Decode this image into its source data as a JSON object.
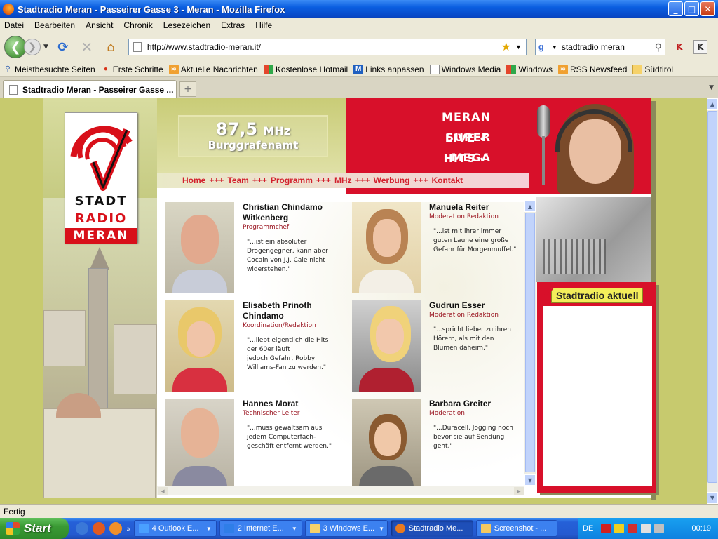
{
  "window": {
    "title": "Stadtradio Meran - Passeirer Gasse 3 - Meran - Mozilla Firefox",
    "min": "_",
    "max": "□",
    "close": "✕"
  },
  "menu": [
    "Datei",
    "Bearbeiten",
    "Ansicht",
    "Chronik",
    "Lesezeichen",
    "Extras",
    "Hilfe"
  ],
  "nav": {
    "url": "http://www.stadtradio-meran.it/",
    "search_value": "stadtradio meran",
    "search_engine_icon": "g",
    "extra1": "K",
    "extra2": "K"
  },
  "bookmarks": [
    {
      "label": "Meistbesuchte Seiten",
      "icon": "search-icon"
    },
    {
      "label": "Erste Schritte",
      "icon": "firefox-icon"
    },
    {
      "label": "Aktuelle Nachrichten",
      "icon": "rss-icon"
    },
    {
      "label": "Kostenlose Hotmail",
      "icon": "windows-icon"
    },
    {
      "label": "Links anpassen",
      "icon": "msn-icon"
    },
    {
      "label": "Windows Media",
      "icon": "page-icon"
    },
    {
      "label": "Windows",
      "icon": "windows-icon"
    },
    {
      "label": "RSS Newsfeed",
      "icon": "rss-icon"
    },
    {
      "label": "Südtirol",
      "icon": "folder-icon"
    }
  ],
  "tab": {
    "label": "Stadtradio Meran - Passeirer Gasse ..."
  },
  "site": {
    "logo": {
      "line1": "STADT",
      "line2": "RADIO",
      "line3": "MERAN"
    },
    "frequency": "87,5",
    "frequency_unit": "MHz",
    "region": "Burggrafenamt",
    "slogans": [
      "MERAN LIVE",
      "SUPER HITS",
      "MEGA OLDIES"
    ],
    "navlinks": [
      "Home",
      "Team",
      "Programm",
      "MHz",
      "Werbung",
      "Kontakt"
    ],
    "nav_separator": "+++",
    "people": [
      {
        "name": "Christian Chindamo Witkenberg",
        "role": "Programmchef",
        "quote": "\"...ist ein absoluter\nDrogengegner, kann aber\nCocain von J.J. Cale nicht\nwiderstehen.\""
      },
      {
        "name": "Manuela Reiter",
        "role": "Moderation Redaktion",
        "quote": "\"...ist mit ihrer immer\nguten Laune eine große\nGefahr für Morgenmuffel.\""
      },
      {
        "name": "Elisabeth Prinoth Chindamo",
        "role": "Koordination/Redaktion",
        "quote": "\"...liebt eigentlich die Hits\nder 60er läuft\njedoch Gefahr, Robby\nWilliams-Fan zu werden.\""
      },
      {
        "name": "Gudrun Esser",
        "role": "Moderation Redaktion",
        "quote": "\"...spricht lieber zu ihren\nHörern, als mit den\nBlumen daheim.\""
      },
      {
        "name": "Hannes Morat",
        "role": "Technischer Leiter",
        "quote": "\"...muss gewaltsam aus\njedem Computerfach-\ngeschäft entfernt werden.\""
      },
      {
        "name": "Barbara Greiter",
        "role": "Moderation",
        "quote": "\"...Duracell, Jogging noch\nbevor sie auf Sendung\ngeht.\""
      }
    ],
    "aktuell_title": "Stadtradio aktuell",
    "colors": {
      "brand_red": "#d8102a",
      "olive": "#c7ca6e",
      "yellow": "#f3ee5a"
    }
  },
  "status": "Fertig",
  "taskbar": {
    "start": "Start",
    "tasks": [
      {
        "label": "4 Outlook E...",
        "color": "#4aa0ff",
        "active": false
      },
      {
        "label": "2 Internet E...",
        "color": "#2f7ee8",
        "active": false
      },
      {
        "label": "3 Windows E...",
        "color": "#f6d26a",
        "active": false
      },
      {
        "label": "Stadtradio Me...",
        "color": "#e87a20",
        "active": true
      },
      {
        "label": "Screenshot - ...",
        "color": "#f4c860",
        "active": false
      }
    ],
    "lang": "DE",
    "clock": "00:19"
  }
}
